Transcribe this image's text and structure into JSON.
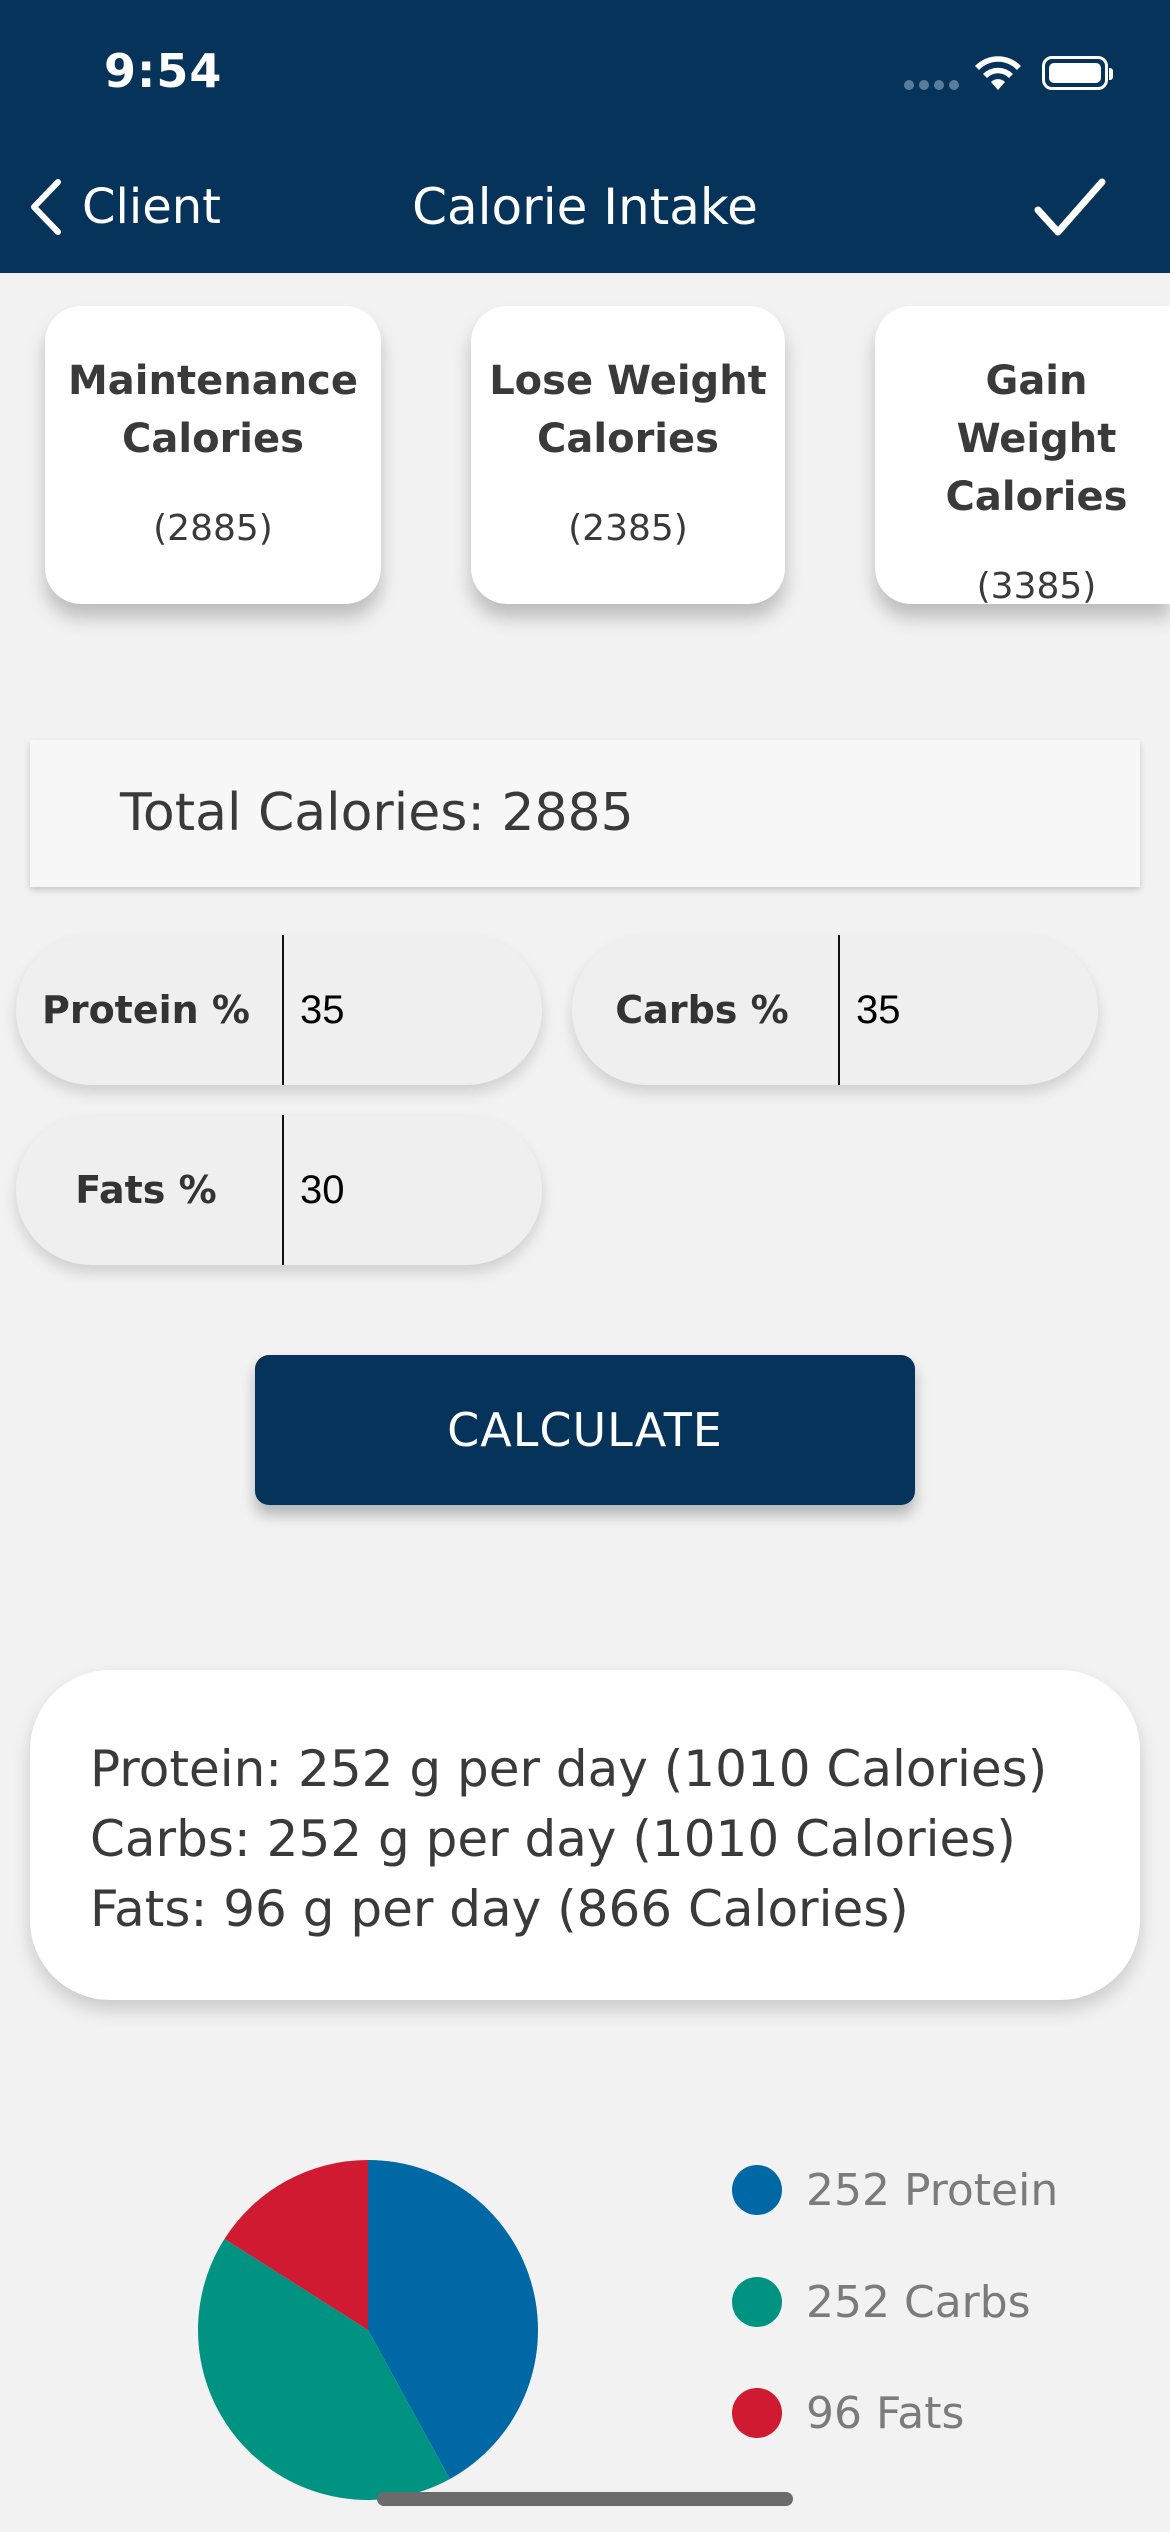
{
  "status_bar": {
    "time": "9:54"
  },
  "nav": {
    "back_label": "Client",
    "title": "Calorie Intake"
  },
  "cards": [
    {
      "title": "Maintenance Calories",
      "value": "(2885)"
    },
    {
      "title": "Lose Weight Calories",
      "value": "(2385)"
    },
    {
      "title": "Gain Weight Calories",
      "value": "(3385)"
    }
  ],
  "total": {
    "text": "Total Calories: 2885"
  },
  "macros": {
    "protein": {
      "label": "Protein %",
      "value": "35"
    },
    "carbs": {
      "label": "Carbs %",
      "value": "35"
    },
    "fats": {
      "label": "Fats %",
      "value": "30"
    }
  },
  "calculate_label": "CALCULATE",
  "results": [
    "Protein: 252 g per day (1010 Calories)",
    "Carbs: 252 g per day (1010 Calories)",
    "Fats: 96 g per day (866 Calories)"
  ],
  "colors": {
    "nav": "#06335a",
    "protein": "#0068a5",
    "carbs": "#009382",
    "fats": "#d01a31"
  },
  "chart_data": {
    "type": "pie",
    "labels": [
      "252 Protein",
      "252 Carbs",
      "96 Fats"
    ],
    "values": [
      252,
      252,
      96
    ],
    "colors": [
      "#0068a5",
      "#009382",
      "#d01a31"
    ],
    "legend": "right"
  }
}
